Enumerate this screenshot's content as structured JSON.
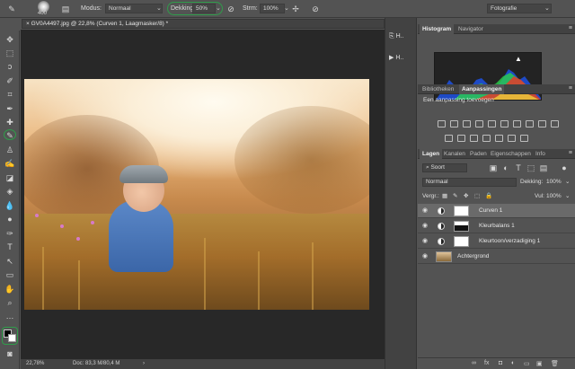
{
  "options_bar": {
    "brush_size": "400",
    "mode_label": "Modus:",
    "mode_value": "Normaal",
    "opacity_label": "Dekking:",
    "opacity_value": "50%",
    "flow_label": "Strm:",
    "flow_value": "100%",
    "workspace_value": "Fotografie"
  },
  "document_tab": {
    "title": "GV0A4497.jpg @ 22,8% (Curven 1, Laagmasker/8) *"
  },
  "status_bar": {
    "zoom": "22,78%",
    "doc_info": "Doc: 83,3 M/80,4 M"
  },
  "strip_buttons": [
    {
      "label": "H.."
    },
    {
      "label": "H.."
    }
  ],
  "histogram_panel": {
    "tabs": [
      "Histogram",
      "Navigator"
    ],
    "active": "Histogram"
  },
  "adjustments_panel": {
    "tabs": [
      "Bibliotheken",
      "Aanpassingen"
    ],
    "active": "Aanpassingen",
    "title": "Een aanpassing toevoegen"
  },
  "layers_panel": {
    "tabs": [
      "Lagen",
      "Kanalen",
      "Paden",
      "Eigenschappen",
      "Info"
    ],
    "active": "Lagen",
    "filter_label": "Soort",
    "blend_mode": "Normaal",
    "opacity_label": "Dekking:",
    "opacity_value": "100%",
    "lock_label": "Vergr.:",
    "fill_label": "Vul:",
    "fill_value": "100%",
    "layers": [
      {
        "name": "Curven 1",
        "selected": true
      },
      {
        "name": "Kleurbalans 1",
        "selected": false
      },
      {
        "name": "Kleurtoon/verzadiging 1",
        "selected": false
      },
      {
        "name": "Achtergrond",
        "selected": false
      }
    ]
  },
  "colors": {
    "accent_green": "#2f9d4a",
    "panel": "#535353",
    "canvas": "#282828"
  }
}
